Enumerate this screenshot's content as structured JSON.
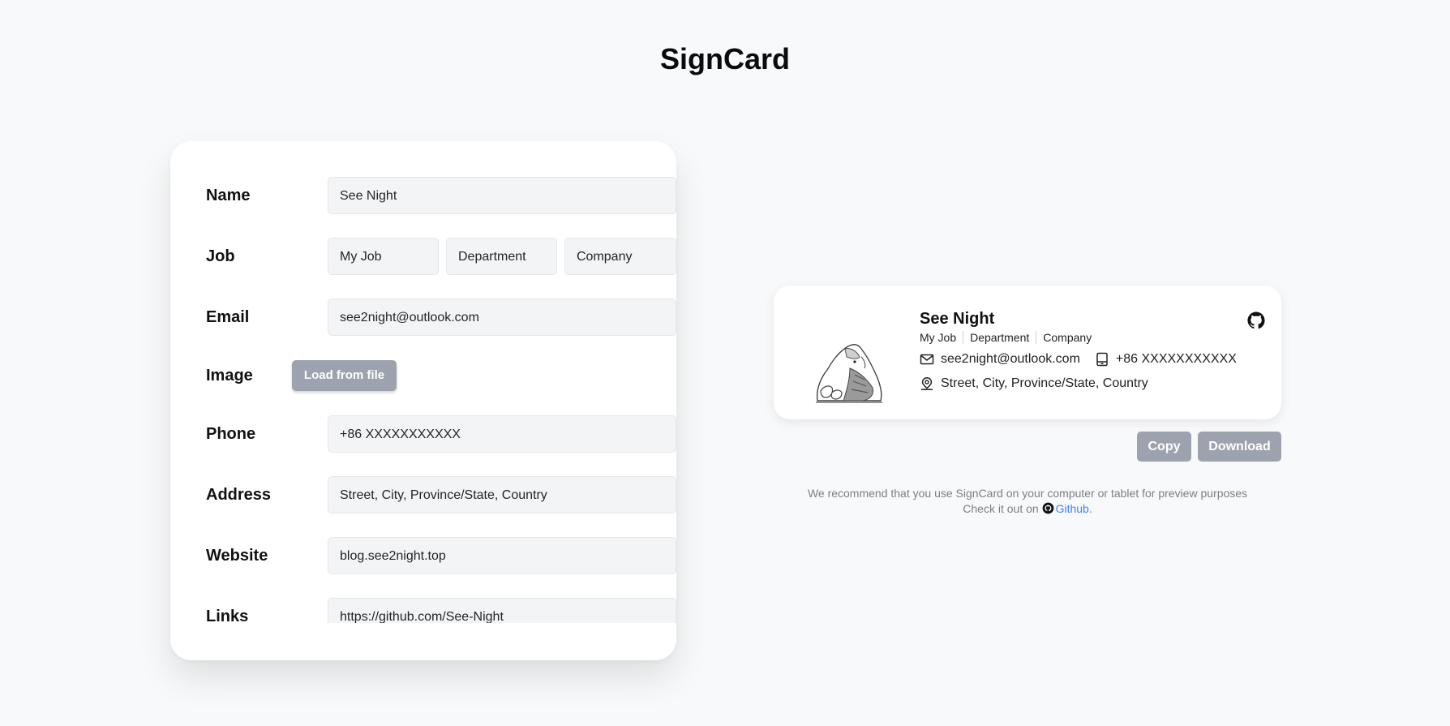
{
  "app": {
    "title": "SignCard"
  },
  "form": {
    "name": {
      "label": "Name",
      "value": "See Night"
    },
    "job": {
      "label": "Job",
      "title_value": "My Job",
      "department_value": "Department",
      "company_value": "Company"
    },
    "email": {
      "label": "Email",
      "value": "see2night@outlook.com"
    },
    "image": {
      "label": "Image",
      "button": "Load from file"
    },
    "phone": {
      "label": "Phone",
      "value": "+86 XXXXXXXXXXX"
    },
    "address": {
      "label": "Address",
      "value": "Street, City, Province/State, Country"
    },
    "website": {
      "label": "Website",
      "value": "blog.see2night.top"
    },
    "links": {
      "label": "Links",
      "value": "https://github.com/See-Night"
    }
  },
  "preview": {
    "name": "See Night",
    "job": "My Job",
    "department": "Department",
    "company": "Company",
    "email": "see2night@outlook.com",
    "phone": "+86 XXXXXXXXXXX",
    "address": "Street, City, Province/State, Country",
    "link_icon": "github-icon"
  },
  "actions": {
    "copy": "Copy",
    "download": "Download"
  },
  "footer": {
    "recommendation": "We recommend that you use SignCard on your computer or tablet for preview purposes",
    "check_prefix": "Check it out on",
    "github_link": "Github",
    "suffix": "."
  },
  "colors": {
    "background": "#f8f9fa",
    "button_gray": "#9ca3af",
    "link_blue": "#3b82f6"
  }
}
